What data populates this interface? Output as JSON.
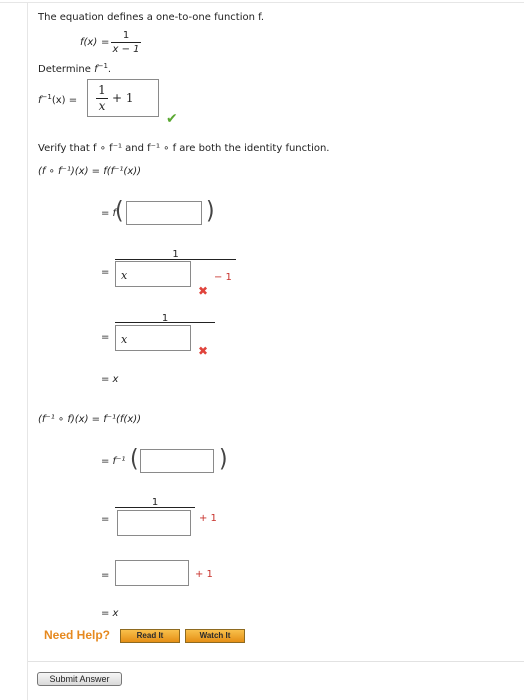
{
  "problem": {
    "intro": "The equation defines a one-to-one function f.",
    "function_def": {
      "lhs": "f(x)",
      "eq": "=",
      "num": "1",
      "den": "x − 1"
    },
    "determine_label": "Determine",
    "determine_target": "f",
    "determine_sup": "−1",
    "determine_end": ".",
    "inverse_answer": {
      "lhs": "f",
      "lhs_sup": "−1",
      "lhs_end": "(x) =",
      "num": "1",
      "den": "x",
      "plus": "+ 1",
      "status": "correct"
    }
  },
  "verify": {
    "prompt": "Verify that f ∘ f⁻¹ and f⁻¹ ∘ f are both the identity function.",
    "part1": {
      "header": "(f ∘ f⁻¹)(x) = f(f⁻¹(x))",
      "step1_prefix": "= f",
      "step1_value": "",
      "step2_prefix": "=",
      "step2_num": "1",
      "step2_box_value": "x",
      "step2_suffix": "− 1",
      "step2_status": "incorrect",
      "step3_prefix": "=",
      "step3_num": "1",
      "step3_box_value": "x",
      "step3_status": "incorrect",
      "result": "= x"
    },
    "part2": {
      "header": "(f⁻¹ ∘ f)(x) = f⁻¹(f(x))",
      "step1_prefix": "= f⁻¹",
      "step1_value": "",
      "step2_prefix": "=",
      "step2_num": "1",
      "step2_box_value": "",
      "step2_suffix": "+ 1",
      "step3_prefix": "=",
      "step3_box_value": "",
      "step3_suffix": "+ 1",
      "result": "= x"
    }
  },
  "help": {
    "label": "Need Help?",
    "read_button": "Read It",
    "watch_button": "Watch It"
  },
  "submit_button": "Submit Answer",
  "icons": {
    "correct": "check-icon",
    "incorrect": "x-mark-icon"
  },
  "colors": {
    "correct": "#5aa832",
    "incorrect": "#e0443c",
    "help": "#e6891f",
    "button_orange": "#f0a22e"
  }
}
